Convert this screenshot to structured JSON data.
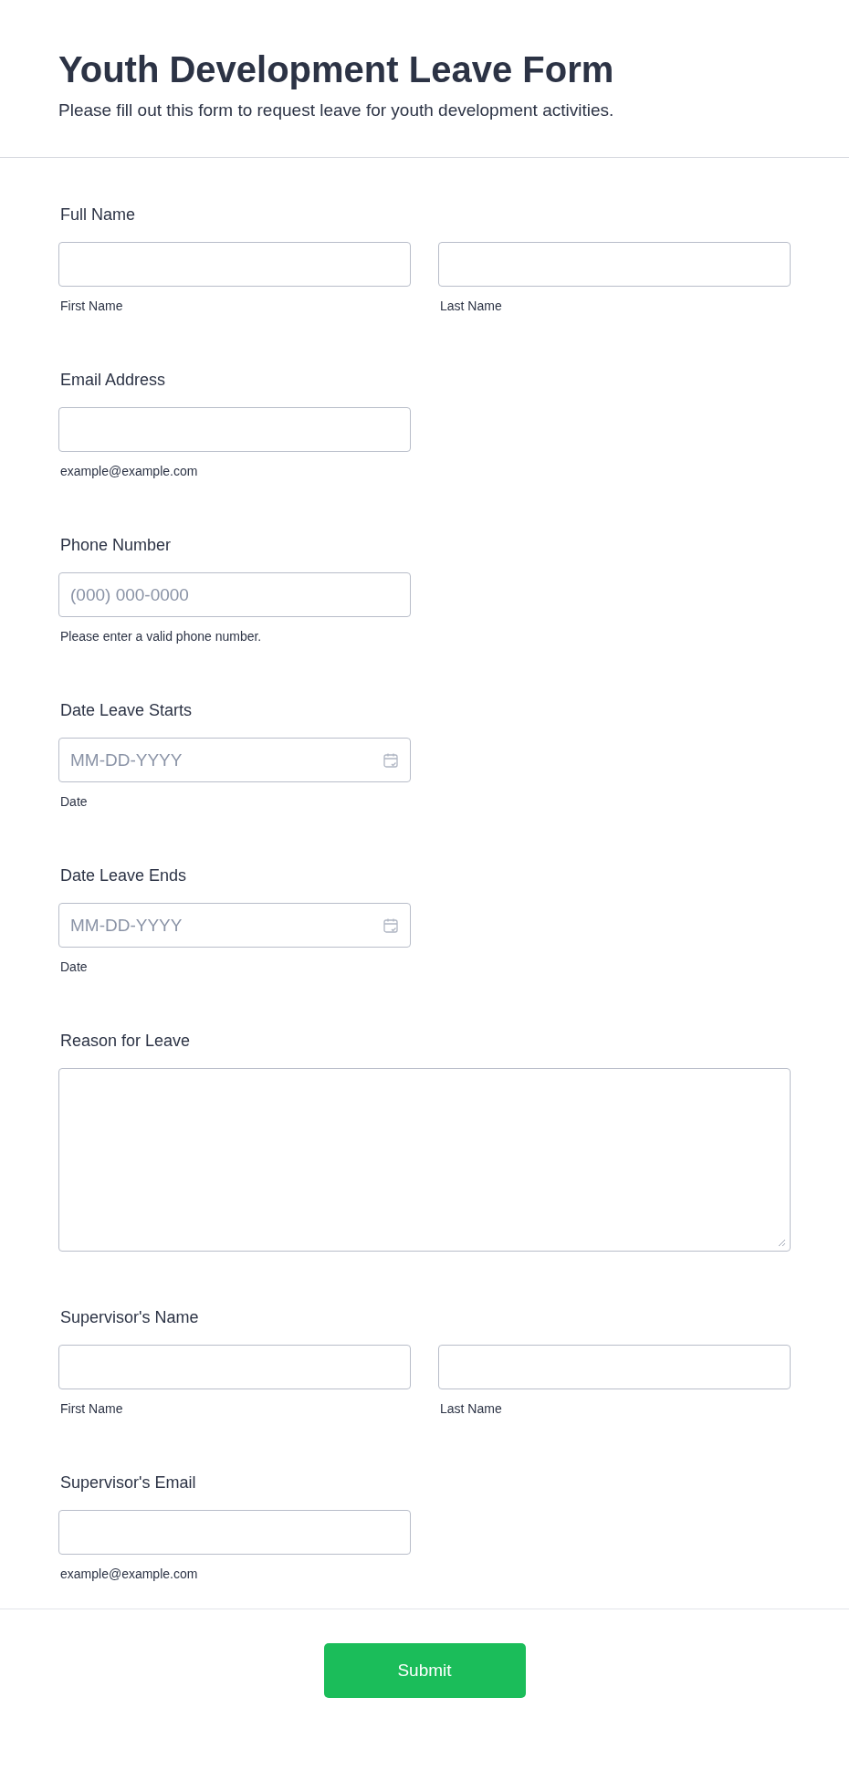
{
  "header": {
    "title": "Youth Development Leave Form",
    "subtitle": "Please fill out this form to request leave for youth development activities."
  },
  "fields": [
    {
      "kind": "name",
      "label": "Full Name",
      "sublabels": [
        "First Name",
        "Last Name"
      ]
    },
    {
      "kind": "email",
      "label": "Email Address",
      "sublabel": "example@example.com"
    },
    {
      "kind": "phone",
      "label": "Phone Number",
      "placeholder": "(000) 000-0000",
      "sublabel": "Please enter a valid phone number."
    },
    {
      "kind": "date",
      "label": "Date Leave Starts",
      "placeholder": "MM-DD-YYYY",
      "sublabel": "Date"
    },
    {
      "kind": "date",
      "label": "Date Leave Ends",
      "placeholder": "MM-DD-YYYY",
      "sublabel": "Date"
    },
    {
      "kind": "textarea",
      "label": "Reason for Leave"
    },
    {
      "kind": "name",
      "label": "Supervisor's Name",
      "sublabels": [
        "First Name",
        "Last Name"
      ]
    },
    {
      "kind": "email",
      "label": "Supervisor's Email",
      "sublabel": "example@example.com"
    }
  ],
  "submit": "Submit"
}
